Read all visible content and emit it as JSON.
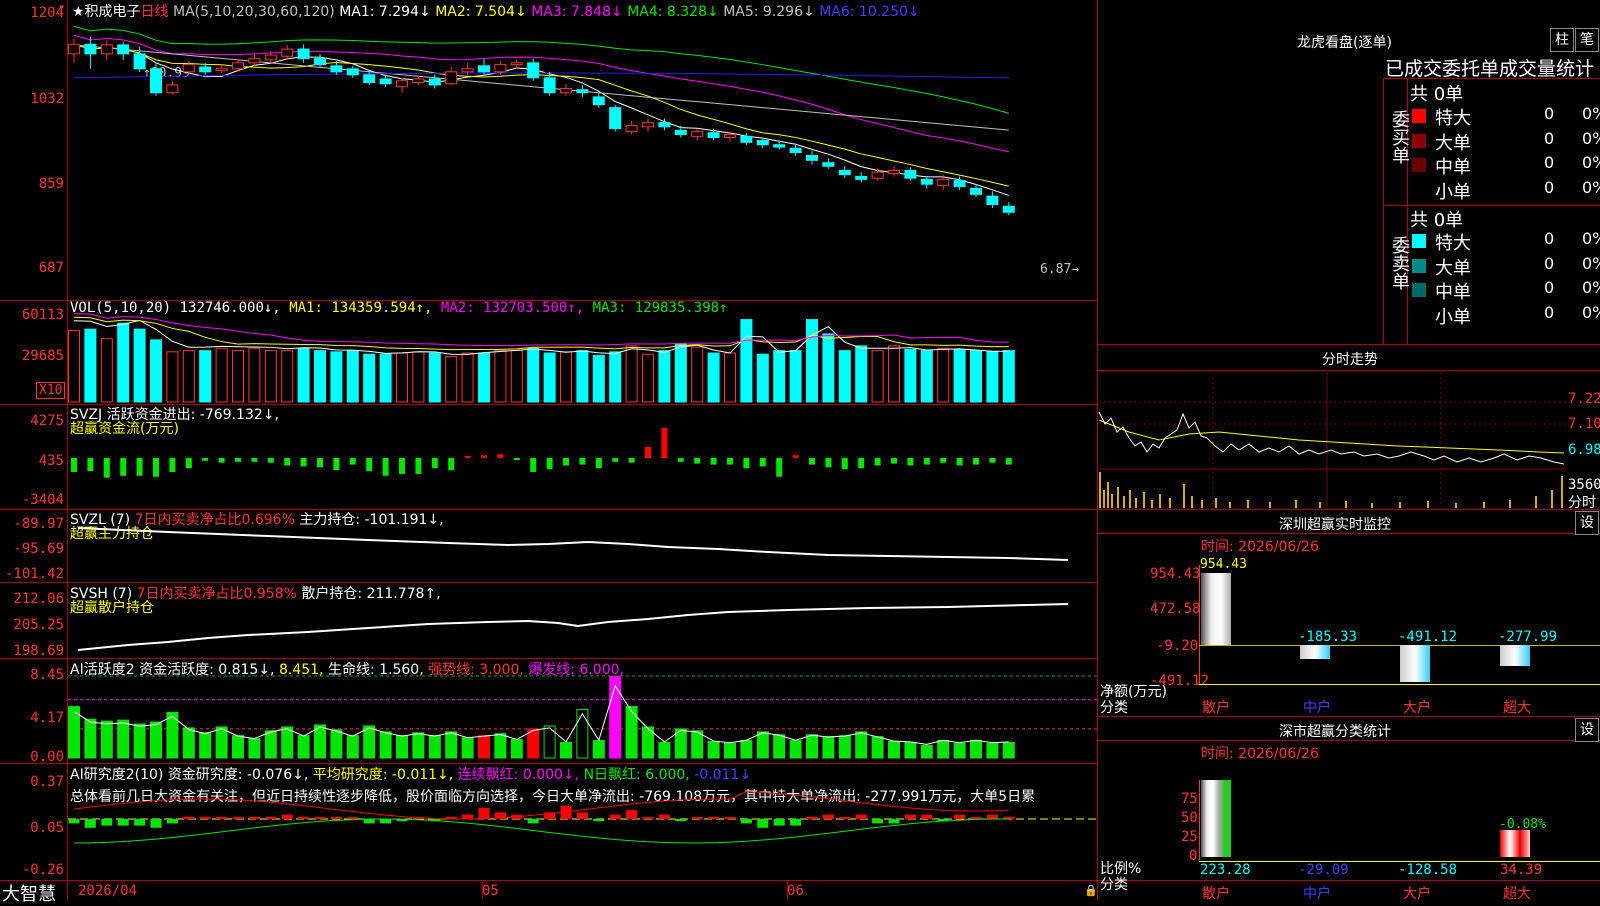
{
  "stock": {
    "name": "★积成电子",
    "period": "日线"
  },
  "ma_legend": {
    "prefix": "MA(5,10,20,30,60,120)",
    "ma1": "MA1: 7.294↓",
    "ma2": "MA2: 7.504↓",
    "ma3": "MA3: 7.848↓",
    "ma4": "MA4: 8.328↓",
    "ma5": "MA5: 9.296↓",
    "ma6": "MA6: 10.250↓"
  },
  "price_axis": [
    "1204",
    "1032",
    "859",
    "687"
  ],
  "price_notes": {
    "high": "10.99",
    "low": "6.87"
  },
  "vol": {
    "title": "VOL(5,10,20)",
    "value": "132746.000↓,",
    "ma1": "MA1: 134359.594↑,",
    "ma2": "MA2: 132703.500↑,",
    "ma3": "MA3: 129835.398↑",
    "axis": [
      "60113",
      "29685"
    ],
    "unit": "X10"
  },
  "svzj": {
    "title": "SVZJ",
    "label": "活跃资金进出: -769.132↓,",
    "sub": "超赢资金流(万元)",
    "axis": [
      "4275",
      "435",
      "-3404"
    ]
  },
  "svzl": {
    "title": "SVZL (7)",
    "p1": "7日内买卖净占比0.696%",
    "p2": "主力持仓: -101.191↓,",
    "sub": "超赢主力持仓",
    "axis": [
      "-89.97",
      "-95.69",
      "-101.42"
    ]
  },
  "svsh": {
    "title": "SVSH (7)",
    "p1": "7日内买卖净占比0.958%",
    "p2": "散户持仓: 211.778↑,",
    "sub": "超赢散户持仓",
    "axis": [
      "212.06",
      "205.25",
      "198.69"
    ]
  },
  "ai_act": {
    "title": "AI活跃度2",
    "p1": "资金活跃度: 0.815↓,",
    "p2": "8.451,",
    "p3": "生命线: 1.560,",
    "p4": "强势线: 3.000,",
    "p5": "爆发线: 6.000,",
    "axis": [
      "8.45",
      "4.17",
      "0.00"
    ]
  },
  "ai_res": {
    "title": "AI研究度2(10)",
    "p1": "资金研究度: -0.076↓,",
    "p2": "平均研究度: -0.011↓,",
    "p3": "连续飘红: 0.000↓,",
    "p4": "N日飘红: 6.000,",
    "p5": "-0.011↓",
    "axis": [
      "0.37",
      "0.05",
      "-0.26"
    ],
    "comment": "总体看前几日大资金有关注，但近日持续性逐步降低，股价面临方向选择，今日大单净流出: -769.108万元，其中特大单净流出: -277.991万元，大单5日累"
  },
  "date_axis": {
    "d1": "2026/04",
    "d2": "05",
    "d3": "06"
  },
  "brand": "大智慧",
  "dragon": {
    "title": "龙虎看盘(逐单)",
    "btn1": "柱",
    "btn2": "笔",
    "sub": "已成交委托单成交量统计",
    "buy_label": "委买单",
    "sell_label": "委卖单",
    "buy_total": "共 0单",
    "sell_total": "共 0单",
    "rows": [
      {
        "name": "特大",
        "val": "0",
        "pct": "0%"
      },
      {
        "name": "大单",
        "val": "0",
        "pct": "0%"
      },
      {
        "name": "中单",
        "val": "0",
        "pct": "0%"
      },
      {
        "name": "小单",
        "val": "0",
        "pct": "0%"
      }
    ],
    "colors": {
      "buy": [
        "#ff0000",
        "#8b0000",
        "#6b0000",
        "#000000"
      ],
      "sell": [
        "#00ffff",
        "#008b8b",
        "#006b6b",
        "#000000"
      ]
    }
  },
  "intraday": {
    "title": "分时走势",
    "axis": [
      "7.22",
      "7.10",
      "6.98"
    ],
    "vol": "3560",
    "unit": "分时"
  },
  "sz_monitor": {
    "title": "深圳超赢实时监控",
    "btn": "设",
    "time": "时间: 2026/06/26",
    "axis": [
      "954.43",
      "472.58",
      "-9.20",
      "-491.12"
    ],
    "ylabel": "净额(万元)",
    "xlabel": "分类",
    "cats": [
      "散户",
      "中户",
      "大户",
      "超大"
    ],
    "values": [
      "954.43",
      "-185.33",
      "-491.12",
      "-277.99"
    ]
  },
  "sz_class": {
    "title": "深市超赢分类统计",
    "btn": "设",
    "time": "时间: 2026/06/26",
    "axis": [
      "75",
      "50",
      "25",
      "0"
    ],
    "ylabel": "比例%",
    "xlabel": "分类",
    "cats": [
      "散户",
      "中户",
      "大户",
      "超大"
    ],
    "values": [
      "223.28",
      "-29.09",
      "-128.58",
      "34.39"
    ],
    "extra": "-0.08%"
  },
  "chart_data": {
    "type": "candlestick",
    "candles": [
      [
        10.7,
        10.86,
        10.95,
        10.55
      ],
      [
        10.86,
        10.7,
        10.99,
        10.45
      ],
      [
        10.7,
        10.85,
        10.92,
        10.6
      ],
      [
        10.85,
        10.7,
        10.9,
        10.6
      ],
      [
        10.7,
        10.45,
        10.82,
        10.4
      ],
      [
        10.45,
        10.05,
        10.55,
        10.0
      ],
      [
        10.05,
        10.18,
        10.25,
        10.02
      ],
      [
        10.4,
        10.52,
        10.58,
        10.35
      ],
      [
        10.48,
        10.4,
        10.55,
        10.35
      ],
      [
        10.42,
        10.46,
        10.52,
        10.38
      ],
      [
        10.45,
        10.55,
        10.62,
        10.4
      ],
      [
        10.55,
        10.62,
        10.7,
        10.5
      ],
      [
        10.6,
        10.68,
        10.75,
        10.55
      ],
      [
        10.66,
        10.78,
        10.85,
        10.6
      ],
      [
        10.78,
        10.62,
        10.86,
        10.55
      ],
      [
        10.62,
        10.52,
        10.7,
        10.48
      ],
      [
        10.5,
        10.4,
        10.58,
        10.35
      ],
      [
        10.45,
        10.35,
        10.5,
        10.3
      ],
      [
        10.35,
        10.22,
        10.42,
        10.18
      ],
      [
        10.28,
        10.2,
        10.35,
        10.15
      ],
      [
        10.15,
        10.25,
        10.3,
        10.05
      ],
      [
        10.22,
        10.28,
        10.34,
        10.18
      ],
      [
        10.28,
        10.18,
        10.36,
        10.12
      ],
      [
        10.2,
        10.4,
        10.48,
        10.18
      ],
      [
        10.4,
        10.45,
        10.55,
        10.35
      ],
      [
        10.5,
        10.4,
        10.62,
        10.35
      ],
      [
        10.4,
        10.52,
        10.58,
        10.35
      ],
      [
        10.52,
        10.55,
        10.6,
        10.45
      ],
      [
        10.55,
        10.3,
        10.62,
        10.25
      ],
      [
        10.3,
        10.05,
        10.4,
        10.0
      ],
      [
        10.05,
        10.12,
        10.2,
        10.0
      ],
      [
        10.1,
        10.05,
        10.18,
        9.98
      ],
      [
        9.98,
        9.85,
        10.05,
        9.8
      ],
      [
        9.8,
        9.45,
        9.85,
        9.4
      ],
      [
        9.4,
        9.5,
        9.58,
        9.35
      ],
      [
        9.48,
        9.55,
        9.62,
        9.4
      ],
      [
        9.55,
        9.48,
        9.62,
        9.42
      ],
      [
        9.42,
        9.35,
        9.5,
        9.3
      ],
      [
        9.32,
        9.4,
        9.45,
        9.25
      ],
      [
        9.38,
        9.3,
        9.45,
        9.25
      ],
      [
        9.3,
        9.35,
        9.4,
        9.22
      ],
      [
        9.32,
        9.22,
        9.38,
        9.18
      ],
      [
        9.25,
        9.18,
        9.3,
        9.12
      ],
      [
        9.18,
        9.14,
        9.25,
        9.1
      ],
      [
        9.12,
        9.05,
        9.2,
        9.0
      ],
      [
        9.0,
        8.92,
        9.08,
        8.85
      ],
      [
        8.88,
        8.82,
        8.95,
        8.78
      ],
      [
        8.75,
        8.68,
        8.82,
        8.62
      ],
      [
        8.65,
        8.6,
        8.72,
        8.55
      ],
      [
        8.62,
        8.72,
        8.78,
        8.58
      ],
      [
        8.7,
        8.75,
        8.82,
        8.65
      ],
      [
        8.75,
        8.62,
        8.8,
        8.58
      ],
      [
        8.6,
        8.52,
        8.66,
        8.45
      ],
      [
        8.5,
        8.6,
        8.68,
        8.42
      ],
      [
        8.58,
        8.48,
        8.65,
        8.42
      ],
      [
        8.45,
        8.35,
        8.52,
        8.3
      ],
      [
        8.32,
        8.18,
        8.4,
        8.12
      ],
      [
        8.15,
        8.05,
        8.22,
        8.0
      ]
    ],
    "ma_price": {
      "ma5": "#ffffff",
      "ma10": "#ffff00",
      "ma20": "#ff00ff",
      "ma30": "#00e600",
      "ma60": "#c0c0c0",
      "ma120": "#2020ff"
    },
    "volume": [
      6.0,
      6.1,
      5.3,
      6.6,
      6.1,
      5.2,
      4.2,
      4.3,
      4.3,
      4.5,
      4.3,
      4.5,
      4.3,
      4.3,
      4.5,
      4.3,
      4.2,
      4.3,
      4.0,
      4.0,
      4.1,
      4.2,
      4.1,
      3.8,
      4.1,
      4.1,
      4.3,
      4.3,
      4.5,
      4.1,
      4.2,
      4.3,
      3.9,
      4.2,
      4.7,
      4.0,
      4.3,
      4.9,
      4.6,
      4.1,
      4.1,
      6.9,
      4.0,
      4.3,
      4.3,
      6.9,
      5.7,
      4.3,
      4.7,
      4.3,
      4.7,
      4.4,
      4.3,
      4.5,
      4.4,
      4.3,
      4.2,
      4.3,
      4.3,
      4.2
    ],
    "fund_flow": [
      -1500,
      -1400,
      -2100,
      -1900,
      -1900,
      -2000,
      -1500,
      -1100,
      -300,
      -500,
      -400,
      -400,
      -500,
      -800,
      -900,
      -1000,
      -1300,
      -700,
      -1400,
      -1900,
      -1700,
      -1700,
      -1100,
      -1300,
      200,
      300,
      400,
      -200,
      -1500,
      -1200,
      -800,
      -700,
      -1100,
      -400,
      -500,
      1200,
      3200,
      -400,
      -600,
      -700,
      -700,
      -1100,
      -900,
      -2000,
      300,
      -700,
      -1000,
      -1200,
      -1100,
      -800,
      -600,
      -800,
      -700,
      -500,
      -800,
      -700,
      -500,
      -700,
      -600,
      -300
    ],
    "activity": [
      5.3,
      4.0,
      3.8,
      3.9,
      3.5,
      3.7,
      4.7,
      3.1,
      2.6,
      3.2,
      2.3,
      2.0,
      2.8,
      3.2,
      2.3,
      3.4,
      2.9,
      2.3,
      3.3,
      2.7,
      2.3,
      2.6,
      2.3,
      2.7,
      2.1,
      2.3,
      2.5,
      1.9,
      3.0,
      3.3,
      1.6,
      5.0,
      1.8,
      8.4,
      5.3,
      3.2,
      1.6,
      3.0,
      2.8,
      1.7,
      1.5,
      1.8,
      2.7,
      2.4,
      1.8,
      2.4,
      2.2,
      2.3,
      2.7,
      2.2,
      1.7,
      1.6,
      1.3,
      1.8,
      1.5,
      1.8,
      1.5,
      1.6,
      1.8,
      1.2
    ],
    "research": [
      -0.02,
      -0.04,
      -0.03,
      -0.03,
      -0.03,
      -0.04,
      -0.02,
      0.01,
      0.01,
      0.01,
      0.0,
      0.01,
      0.01,
      0.02,
      0.01,
      0.01,
      0.0,
      0.0,
      -0.02,
      -0.02,
      -0.01,
      0.0,
      -0.01,
      0.01,
      0.02,
      0.05,
      0.03,
      0.02,
      -0.02,
      0.03,
      0.06,
      0.03,
      -0.01,
      0.02,
      0.04,
      0.0,
      0.02,
      -0.01,
      0.0,
      0.01,
      0.0,
      -0.02,
      -0.04,
      -0.03,
      -0.03,
      0.01,
      0.02,
      0.0,
      0.02,
      -0.02,
      -0.02,
      0.02,
      0.02,
      -0.01,
      0.02,
      0.0,
      0.02,
      0.01,
      0.0,
      -0.04
    ]
  }
}
